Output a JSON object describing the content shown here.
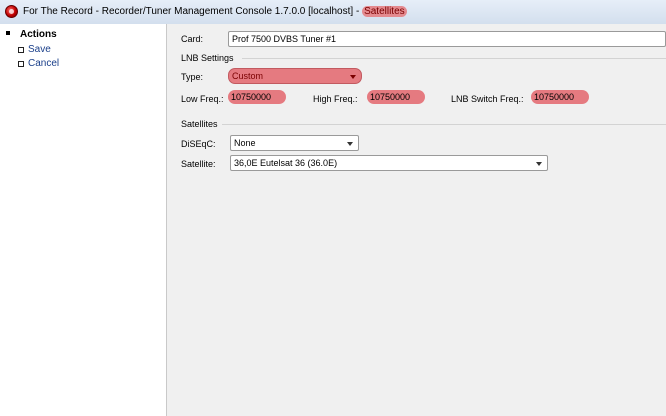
{
  "window": {
    "title_prefix": "For The Record - Recorder/Tuner Management Console 1.7.0.0 [localhost] - ",
    "title_section": "Satellites"
  },
  "sidebar": {
    "header": "Actions",
    "items": [
      {
        "label": "Save"
      },
      {
        "label": "Cancel"
      }
    ]
  },
  "card": {
    "label": "Card:",
    "value": "Prof 7500 DVBS Tuner #1"
  },
  "lnb": {
    "group_label": "LNB Settings",
    "type_label": "Type:",
    "type_value": "Custom",
    "low_label": "Low Freq.:",
    "low_value": "10750000",
    "high_label": "High Freq.:",
    "high_value": "10750000",
    "switch_label": "LNB Switch Freq.:",
    "switch_value": "10750000"
  },
  "satellites": {
    "group_label": "Satellites",
    "diseqc_label": "DiSEqC:",
    "diseqc_value": "None",
    "satellite_label": "Satellite:",
    "satellite_value": "36,0E Eutelsat 36 (36.0E)"
  },
  "colors": {
    "highlight": "#e57a80",
    "link": "#1a3f8a"
  }
}
